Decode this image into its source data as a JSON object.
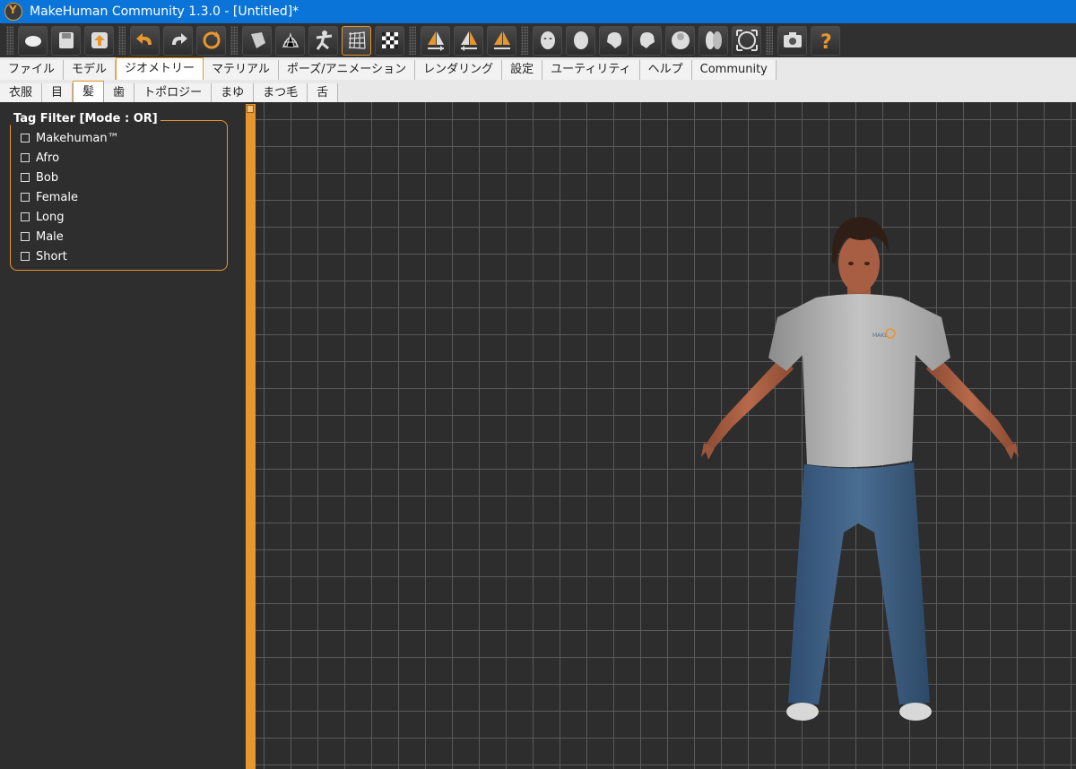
{
  "window": {
    "title": "MakeHuman Community 1.3.0 - [Untitled]*"
  },
  "toolbar": {
    "groups": [
      [
        "file-new-icon",
        "save-icon",
        "export-icon"
      ],
      [
        "undo-icon",
        "redo-icon",
        "reset-icon"
      ],
      [
        "smooth-icon",
        "wireframe-icon",
        "pose-icon",
        "grid-icon",
        "background-icon"
      ],
      [
        "symmetry-right-icon",
        "symmetry-left-icon",
        "symmetry-icon"
      ],
      [
        "front-view-icon",
        "back-view-icon",
        "left-view-icon",
        "right-view-icon",
        "top-view-icon",
        "bottom-view-icon",
        "reset-camera-icon"
      ],
      [
        "screenshot-icon",
        "help-icon"
      ]
    ],
    "active": "grid-icon"
  },
  "main_tabs": [
    {
      "label": "ファイル"
    },
    {
      "label": "モデル"
    },
    {
      "label": "ジオメトリー",
      "active": true
    },
    {
      "label": "マテリアル"
    },
    {
      "label": "ポーズ/アニメーション"
    },
    {
      "label": "レンダリング"
    },
    {
      "label": "設定"
    },
    {
      "label": "ユーティリティ"
    },
    {
      "label": "ヘルプ"
    },
    {
      "label": "Community"
    }
  ],
  "sub_tabs": [
    {
      "label": "衣服"
    },
    {
      "label": "目"
    },
    {
      "label": "髪",
      "active": true
    },
    {
      "label": "歯"
    },
    {
      "label": "トポロジー"
    },
    {
      "label": "まゆ"
    },
    {
      "label": "まつ毛"
    },
    {
      "label": "舌"
    }
  ],
  "tag_filter": {
    "title": "Tag Filter [Mode : OR]",
    "tags": [
      {
        "label": "Makehuman™",
        "checked": false
      },
      {
        "label": "Afro",
        "checked": false
      },
      {
        "label": "Bob",
        "checked": false
      },
      {
        "label": "Female",
        "checked": false
      },
      {
        "label": "Long",
        "checked": false
      },
      {
        "label": "Male",
        "checked": false
      },
      {
        "label": "Short",
        "checked": false
      }
    ]
  },
  "colors": {
    "accent": "#e8962e",
    "titlebar": "#0a74d8",
    "background": "#2b2b2b"
  }
}
